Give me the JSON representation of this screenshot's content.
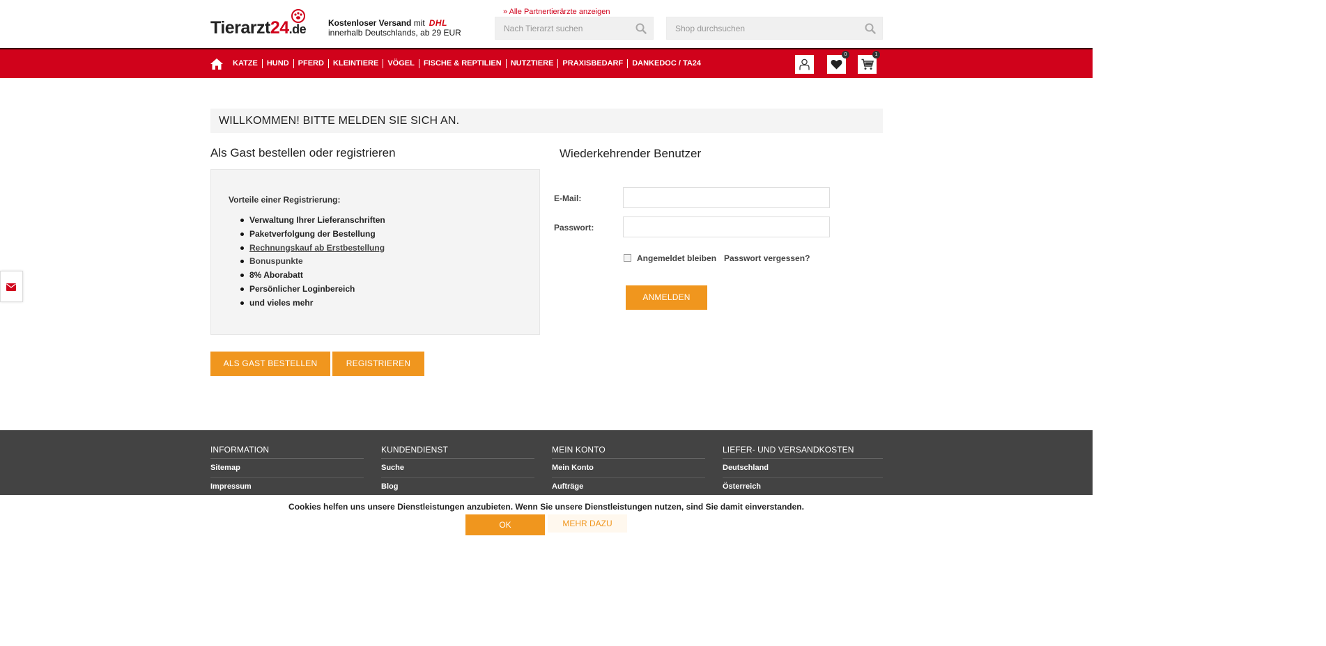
{
  "header": {
    "logo": {
      "main": "Tierarzt",
      "num": "24",
      "tld": ".de"
    },
    "shipping": {
      "bold": "Kostenloser Versand",
      "mid": " mit",
      "carrier": "DHL",
      "line2": "innerhalb Deutschlands, ab 29 EUR"
    },
    "partner_link": "» Alle Partnertierärzte anzeigen",
    "vet_search": {
      "placeholder": "Nach Tierarzt suchen"
    },
    "shop_search": {
      "placeholder": "Shop durchsuchen"
    }
  },
  "nav": {
    "items": [
      "KATZE",
      "HUND",
      "PFERD",
      "KLEINTIERE",
      "VÖGEL",
      "FISCHE & REPTILIEN",
      "NUTZTIERE",
      "PRAXISBEDARF",
      "DANKEDOC / TA24"
    ],
    "wishlist_count": "0",
    "cart_count": "1"
  },
  "main": {
    "welcome": "WILLKOMMEN! BITTE MELDEN SIE SICH AN.",
    "guest": {
      "title": "Als Gast bestellen oder registrieren",
      "benefits_heading": "Vorteile einer Registrierung:",
      "benefits": [
        "Verwaltung Ihrer Lieferanschriften",
        "Paketverfolgung der Bestellung",
        "Rechnungskauf ab Erstbestellung",
        "Bonuspunkte",
        "8% Aborabatt",
        "Persönlicher Loginbereich",
        "und vieles mehr"
      ],
      "guest_button": "ALS GAST BESTELLEN",
      "register_button": "REGISTRIEREN"
    },
    "returning": {
      "title": "Wiederkehrender Benutzer",
      "email_label": "E-Mail:",
      "email_value": "",
      "password_label": "Passwort:",
      "password_value": "",
      "remember_label": "Angemeldet bleiben",
      "forgot_link": "Passwort vergessen?",
      "login_button": "ANMELDEN"
    }
  },
  "footer": {
    "columns": [
      {
        "heading": "INFORMATION",
        "links": [
          "Sitemap",
          "Impressum"
        ]
      },
      {
        "heading": "KUNDENDIENST",
        "links": [
          "Suche",
          "Blog"
        ]
      },
      {
        "heading": "MEIN KONTO",
        "links": [
          "Mein Konto",
          "Aufträge"
        ]
      },
      {
        "heading": "LIEFER- UND VERSANDKOSTEN",
        "links": [
          "Deutschland",
          "Österreich"
        ]
      }
    ]
  },
  "cookie": {
    "text": "Cookies helfen uns unsere Dienstleistungen anzubieten. Wenn Sie unsere Dienstleistungen nutzen, sind Sie damit einverstanden.",
    "ok": "OK",
    "more": "MEHR DAZU"
  },
  "colors": {
    "brand_red": "#d0021b",
    "accent_orange": "#f0961e",
    "footer_bg": "#434343"
  },
  "icons": [
    "home-icon",
    "search-icon",
    "user-icon",
    "heart-icon",
    "cart-icon",
    "mail-icon"
  ]
}
